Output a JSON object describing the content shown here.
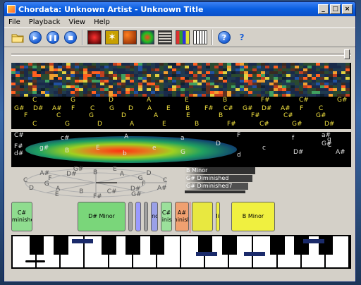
{
  "window": {
    "title": "Chordata: Unknown Artist - Unknown Title",
    "minimize_glyph": "_",
    "maximize_glyph": "□",
    "close_glyph": "×"
  },
  "menu": [
    "File",
    "Playback",
    "View",
    "Help"
  ],
  "toolbar": {
    "icons": [
      "open-folder-icon",
      "play-icon",
      "pause-icon",
      "stop-icon",
      "spectrum-view-icon",
      "star-view-icon",
      "circles-view-icon",
      "blob-view-icon",
      "lines-view-icon",
      "bars-view-icon",
      "keyboard-view-icon",
      "help-icon",
      "whatsthis-icon"
    ],
    "help_glyph": "?",
    "whatsthis_glyph": "?"
  },
  "seek": {
    "position": 1.0
  },
  "note_row_top": [
    "C",
    "G",
    "D",
    "A",
    "E",
    "B",
    "F#",
    "C#",
    "G#"
  ],
  "note_row_mid": [
    "G#",
    "D#",
    "A#",
    "F",
    "C",
    "G",
    "D",
    "A",
    "E",
    "B",
    "F#",
    "C#",
    "G#",
    "D#",
    "A#",
    "F",
    "C"
  ],
  "note_row_mid2": [
    "F",
    "C",
    "G",
    "D",
    "A",
    "E",
    "B",
    "F#",
    "C#",
    "G#"
  ],
  "note_row_bottom": [
    "C",
    "G",
    "D",
    "A",
    "E",
    "B",
    "F#",
    "C#",
    "G#",
    "D#"
  ],
  "blob_labels": [
    "C#",
    "c#",
    "F#",
    "g#",
    "d#",
    "B",
    "E",
    "b",
    "A",
    "e",
    "a",
    "G",
    "D",
    "d",
    "F",
    "c",
    "f",
    "g",
    "C",
    "D#",
    "G#",
    "a#",
    "A#"
  ],
  "circle_labels": [
    "B",
    "E",
    "A",
    "D",
    "G",
    "C",
    "F",
    "A#",
    "D#",
    "G#",
    "C#",
    "F#",
    "B",
    "E",
    "A",
    "D",
    "G",
    "C",
    "F",
    "A#",
    "D#",
    "G#"
  ],
  "chord_candidates": [
    "B Minor",
    "G# Diminished",
    "G# Diminished7",
    ""
  ],
  "chord_blocks": [
    {
      "label": "C#\nDiminished",
      "color": "#8fdc8f"
    },
    {
      "label": "D# Minor",
      "color": "#7ad67a"
    },
    {
      "label": "",
      "color": "#a0a0a0"
    },
    {
      "label": "",
      "color": "#9a9aff"
    },
    {
      "label": "",
      "color": "#a0a0a0"
    },
    {
      "label": "Ind",
      "color": "#9aa0e8"
    },
    {
      "label": "C#\nDiminished",
      "color": "#9be09b"
    },
    {
      "label": "A#\nDiminished",
      "color": "#f0a070"
    },
    {
      "label": "",
      "color": "#e8e840"
    },
    {
      "label": "B Minor",
      "color": "#f0f040"
    },
    {
      "label": "B Minor",
      "color": "#f0f040"
    }
  ],
  "colors": {
    "heat_low": "#1a2a4a",
    "heat_high": "#ff6020",
    "note_text": "#f0e040"
  }
}
